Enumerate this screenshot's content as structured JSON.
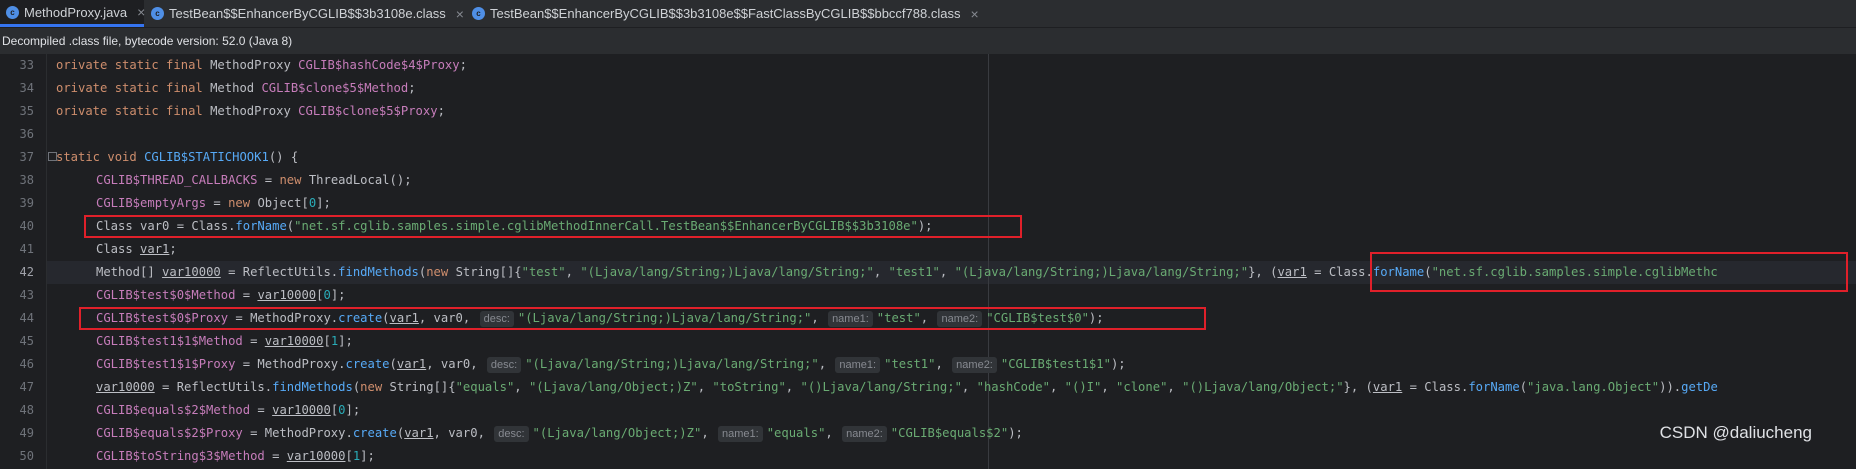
{
  "tabs": [
    {
      "label": "MethodProxy.java",
      "icon": "java-class-icon",
      "active": true
    },
    {
      "label": "TestBean$$EnhancerByCGLIB$$3b3108e.class",
      "icon": "class-file-icon",
      "active": false
    },
    {
      "label": "TestBean$$EnhancerByCGLIB$$3b3108e$$FastClassByCGLIB$$bbccf788.class",
      "icon": "class-file-icon",
      "active": false
    }
  ],
  "banner": {
    "text": "Decompiled .class file, bytecode version: 52.0 (Java 8)"
  },
  "editor": {
    "line_numbers": [
      "33",
      "34",
      "35",
      "36",
      "37",
      "38",
      "39",
      "40",
      "41",
      "42",
      "43",
      "44",
      "45",
      "46",
      "47",
      "48",
      "49",
      "50"
    ],
    "current_line": "42",
    "lines": {
      "l33": {
        "a": "orivate static final ",
        "b": "MethodProxy ",
        "c": "CGLIB$hashCode$4$Proxy",
        ";": ";"
      },
      "l34": {
        "a": "orivate static final ",
        "b": "Method ",
        "c": "CGLIB$clone$5$Method"
      },
      "l35": {
        "a": "orivate static final ",
        "b": "MethodProxy ",
        "c": "CGLIB$clone$5$Proxy"
      },
      "l37": {
        "a": "static void ",
        "b": "CGLIB$STATICHOOK1",
        "c": "() {"
      },
      "l38": {
        "a": "CGLIB$THREAD_CALLBACKS",
        "b": " = ",
        "c": "new ",
        "d": "ThreadLocal",
        "e": "();"
      },
      "l39": {
        "a": "CGLIB$emptyArgs",
        "b": " = ",
        "c": "new ",
        "d": "Object",
        "e": "[",
        "f": "0",
        "g": "];"
      },
      "l40": {
        "a": "Class var0 = Class.",
        "b": "forName",
        "c": "(",
        "d": "\"net.sf.cglib.samples.simple.cglibMethodInnerCall.TestBean$$EnhancerByCGLIB$$3b3108e\"",
        "e": ");"
      },
      "l41": {
        "a": "Class ",
        "b": "var1",
        ";": ";"
      },
      "l42": {
        "a": "Method[] ",
        "b": "var10000",
        " = ": " = ReflectUtils.",
        "c": "findMethods",
        "d": "(",
        "e": "new ",
        "f": "String",
        "g": "[]{",
        "h": "\"test\"",
        "i": ", ",
        "j": "\"(Ljava/lang/String;)Ljava/lang/String;\"",
        "k": ", ",
        "l": "\"test1\"",
        "m": ", ",
        "n": "\"(Ljava/lang/String;)Ljava/lang/String;\"",
        "o": "}, (",
        "p": "var1",
        "q": " = Class.",
        "r": "forName",
        "s": "(",
        "t": "\"net.sf.cglib.samples.simple.cglibMethc"
      },
      "l43": {
        "a": "CGLIB$test$0$Method",
        "b": " = ",
        "c": "var10000",
        "d": "[",
        "e": "0",
        "f": "];"
      },
      "l44": {
        "a": "CGLIB$test$0$Proxy",
        "b": " = MethodProxy.",
        "c": "create",
        "d": "(",
        "e": "var1",
        "f": ", var0, ",
        "h1": "desc:",
        "g": "\"(Ljava/lang/String;)Ljava/lang/String;\"",
        "i": ", ",
        "h2": "name1:",
        "j": "\"test\"",
        "k": ", ",
        "h3": "name2:",
        "l": "\"CGLIB$test$0\"",
        "m": ");"
      },
      "l45": {
        "a": "CGLIB$test1$1$Method",
        "b": " = ",
        "c": "var10000",
        "d": "[",
        "e": "1",
        "f": "];"
      },
      "l46": {
        "a": "CGLIB$test1$1$Proxy",
        "b": " = MethodProxy.",
        "c": "create",
        "d": "(",
        "e": "var1",
        "f": ", var0, ",
        "h1": "desc:",
        "g": "\"(Ljava/lang/String;)Ljava/lang/String;\"",
        "i": ", ",
        "h2": "name1:",
        "j": "\"test1\"",
        "k": ", ",
        "h3": "name2:",
        "l": "\"CGLIB$test1$1\"",
        "m": ");"
      },
      "l47": {
        "a": "var10000",
        "b": " = ReflectUtils.",
        "c": "findMethods",
        "d": "(",
        "e": "new ",
        "f": "String",
        "g": "[]{",
        "h": "\"equals\"",
        "i": ", ",
        "j": "\"(Ljava/lang/Object;)Z\"",
        "k": ", ",
        "l": "\"toString\"",
        "m": ", ",
        "n": "\"()Ljava/lang/String;\"",
        "o": ", ",
        "p": "\"hashCode\"",
        "q": ", ",
        "r": "\"()I\"",
        "s": ", ",
        "t": "\"clone\"",
        "u": ", ",
        "v": "\"()Ljava/lang/Object;\"",
        "w": "}, (",
        "x": "var1",
        "y": " = Class.",
        "z": "forName",
        "aa": "(",
        "ab": "\"java.lang.Object\"",
        "ac": ")).",
        "ad": "getDe"
      },
      "l48": {
        "a": "CGLIB$equals$2$Method",
        "b": " = ",
        "c": "var10000",
        "d": "[",
        "e": "0",
        "f": "];"
      },
      "l49": {
        "a": "CGLIB$equals$2$Proxy",
        "b": " = MethodProxy.",
        "c": "create",
        "d": "(",
        "e": "var1",
        "f": ", var0, ",
        "h1": "desc:",
        "g": "\"(Ljava/lang/Object;)Z\"",
        "i": ", ",
        "h2": "name1:",
        "j": "\"equals\"",
        "k": ", ",
        "h3": "name2:",
        "l": "\"CGLIB$equals$2\"",
        "m": ");"
      },
      "l50": {
        "a": "CGLIB$toString$3$Method",
        "b": " = ",
        "c": "var10000",
        "d": "[",
        "e": "1",
        "f": "];"
      }
    }
  },
  "watermark": "CSDN @daliucheng",
  "colors": {
    "highlight_box": "#e0202a",
    "tab_accent": "#3574f0"
  }
}
